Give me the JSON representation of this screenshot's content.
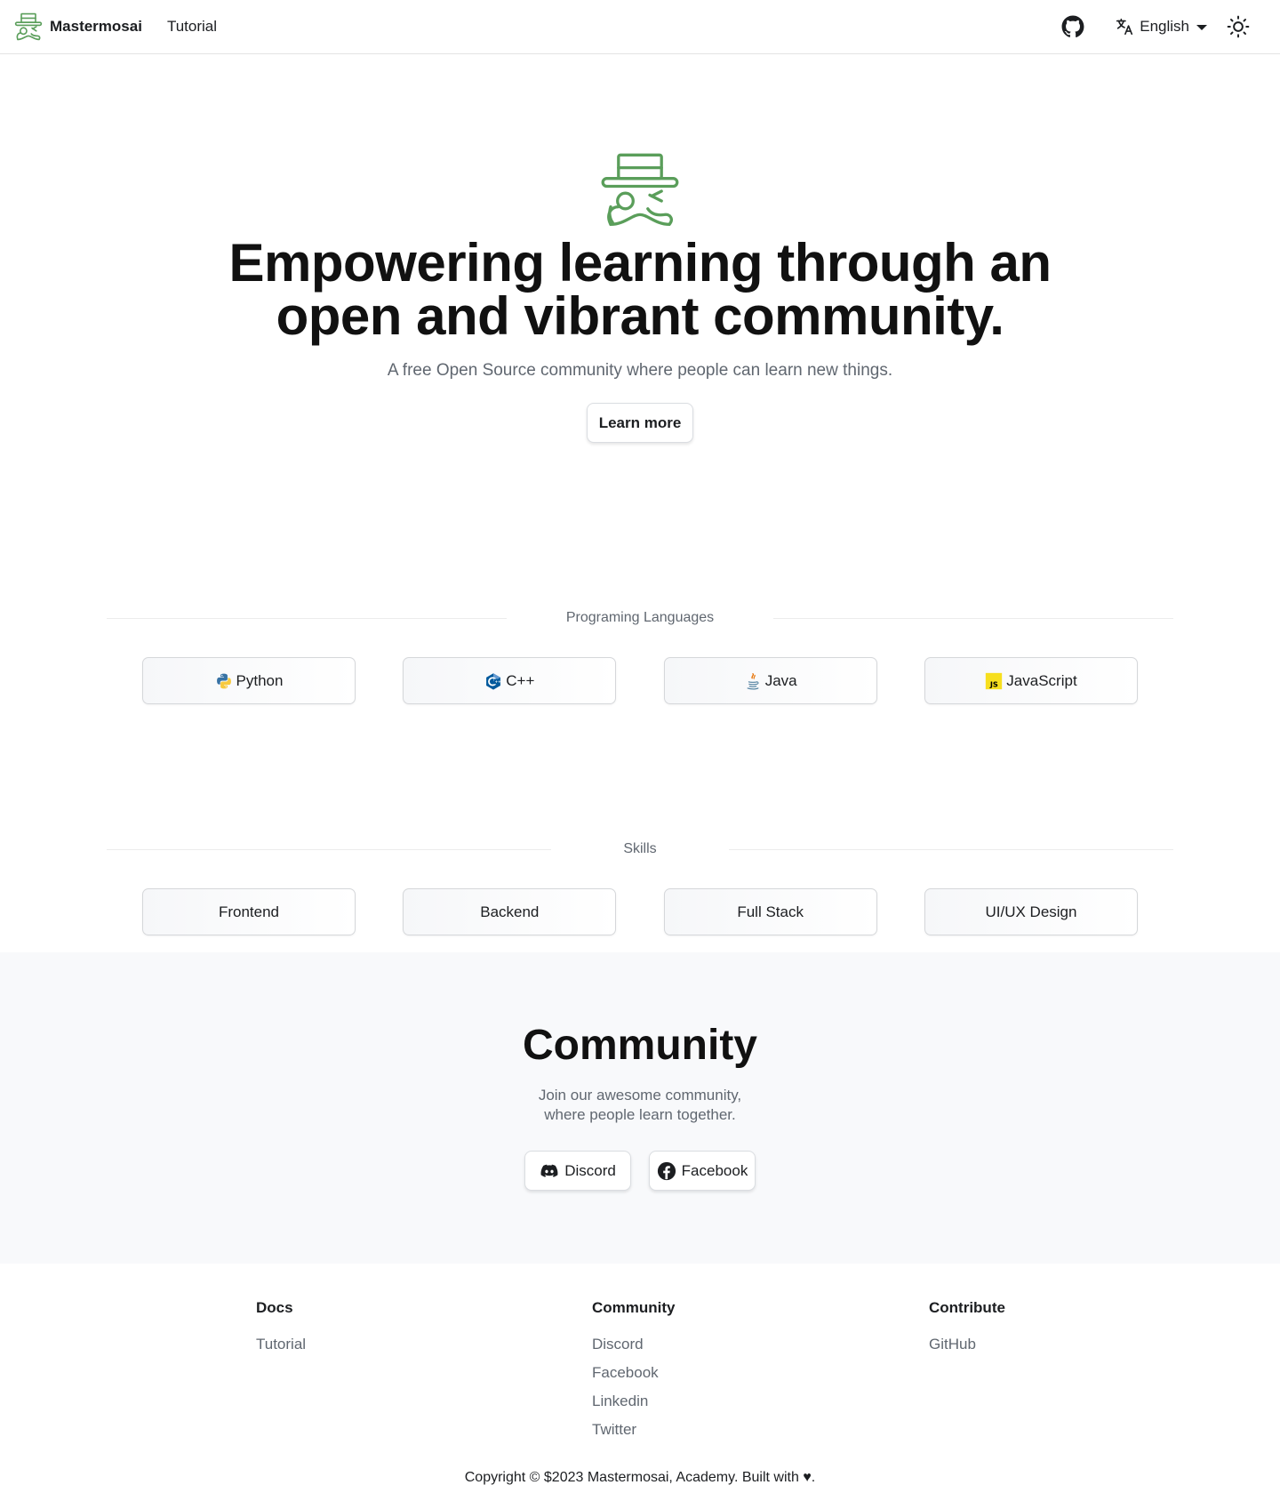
{
  "navbar": {
    "brand": "Mastermosai",
    "links": [
      "Tutorial"
    ],
    "language": "English"
  },
  "hero": {
    "title_line1": "Empowering learning through an",
    "title_line2": "open and vibrant community.",
    "subtitle": "A free Open Source community where people can learn new things.",
    "cta": "Learn more"
  },
  "languages": {
    "heading": "Programing Languages",
    "items": [
      {
        "label": "Python",
        "icon": "python-icon"
      },
      {
        "label": "C++",
        "icon": "cpp-icon"
      },
      {
        "label": "Java",
        "icon": "java-icon"
      },
      {
        "label": "JavaScript",
        "icon": "javascript-icon"
      }
    ]
  },
  "skills": {
    "heading": "Skills",
    "items": [
      {
        "label": "Frontend"
      },
      {
        "label": "Backend"
      },
      {
        "label": "Full Stack"
      },
      {
        "label": "UI/UX Design"
      }
    ]
  },
  "community": {
    "title": "Community",
    "desc_line1": "Join our awesome community,",
    "desc_line2": "where people learn together.",
    "buttons": [
      {
        "label": "Discord",
        "icon": "discord-icon"
      },
      {
        "label": "Facebook",
        "icon": "facebook-icon"
      }
    ]
  },
  "footer": {
    "columns": [
      {
        "title": "Docs",
        "links": [
          "Tutorial"
        ]
      },
      {
        "title": "Community",
        "links": [
          "Discord",
          "Facebook",
          "Linkedin",
          "Twitter"
        ]
      },
      {
        "title": "Contribute",
        "links": [
          "GitHub"
        ]
      }
    ],
    "copyright": "Copyright © $2023 Mastermosai, Academy. Built with ♥."
  },
  "colors": {
    "brand_green": "#5a9e5a",
    "text": "#1c1e21",
    "muted": "#606770",
    "community_bg": "#f8f9fb"
  }
}
